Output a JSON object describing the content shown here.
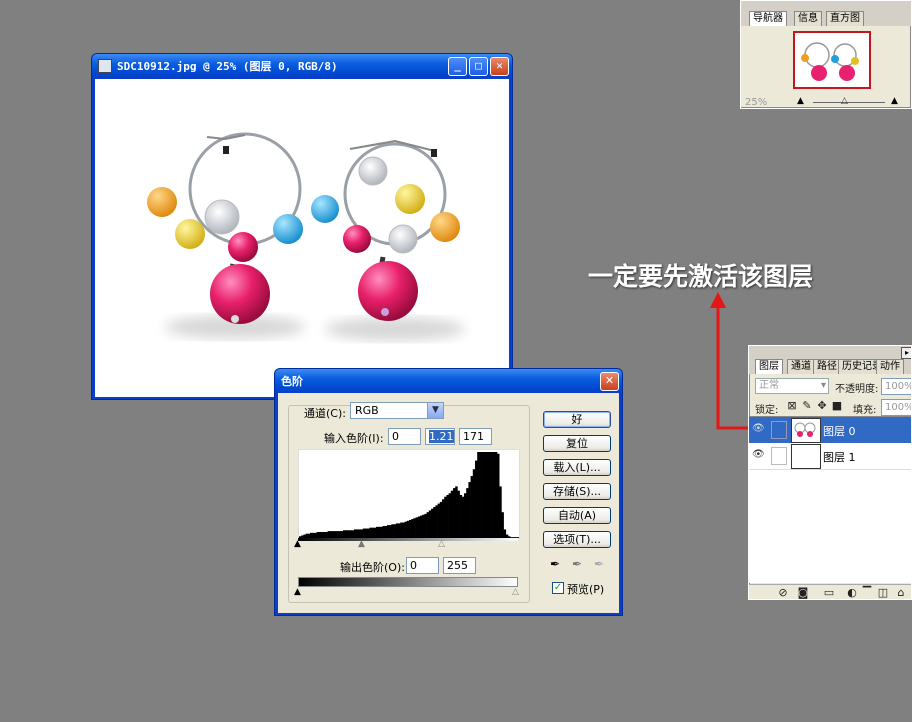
{
  "doc_window": {
    "title": "SDC10912.jpg @ 25% (图层 0, RGB/8)",
    "min_glyph": "_",
    "max_glyph": "□",
    "close_glyph": "✕"
  },
  "navigator": {
    "tabs": [
      "导航器",
      "信息",
      "直方图"
    ],
    "zoom": "25%"
  },
  "annotation": {
    "text": "一定要先激活该图层",
    "color": "#ff2020"
  },
  "levels": {
    "title": "色阶",
    "channel_label": "通道(C):",
    "channel_value": "RGB",
    "input_label": "输入色阶(I):",
    "input_values": [
      "0",
      "1.21",
      "171"
    ],
    "output_label": "输出色阶(O):",
    "output_values": [
      "0",
      "255"
    ],
    "buttons": [
      "好",
      "复位",
      "载入(L)...",
      "存储(S)...",
      "自动(A)",
      "选项(T)..."
    ],
    "preview_label": "预览(P)",
    "preview_checked": true,
    "histogram_values": [
      2,
      3,
      4,
      5,
      5,
      6,
      6,
      6,
      7,
      7,
      7,
      7,
      7,
      8,
      8,
      8,
      8,
      8,
      8,
      8,
      9,
      9,
      9,
      9,
      9,
      10,
      10,
      10,
      10,
      11,
      11,
      11,
      12,
      12,
      12,
      13,
      13,
      13,
      14,
      14,
      15,
      15,
      16,
      16,
      17,
      17,
      18,
      18,
      19,
      20,
      21,
      22,
      23,
      24,
      25,
      26,
      27,
      28,
      30,
      32,
      34,
      36,
      38,
      40,
      42,
      45,
      48,
      50,
      52,
      55,
      58,
      60,
      55,
      50,
      48,
      52,
      58,
      65,
      72,
      80,
      90,
      100,
      100,
      100,
      100,
      100,
      100,
      100,
      100,
      100,
      98,
      60,
      30,
      10,
      4,
      2,
      1,
      1,
      1,
      1
    ]
  },
  "layers": {
    "tabs": [
      "图层",
      "通道",
      "路径",
      "历史记录",
      "动作"
    ],
    "blend_mode": "正常",
    "opacity_label": "不透明度:",
    "opacity_value": "100%",
    "lock_label": "锁定:",
    "fill_label": "填充:",
    "fill_value": "100%",
    "items": [
      {
        "name": "图层 0",
        "selected": true
      },
      {
        "name": "图层 1",
        "selected": false
      }
    ]
  }
}
